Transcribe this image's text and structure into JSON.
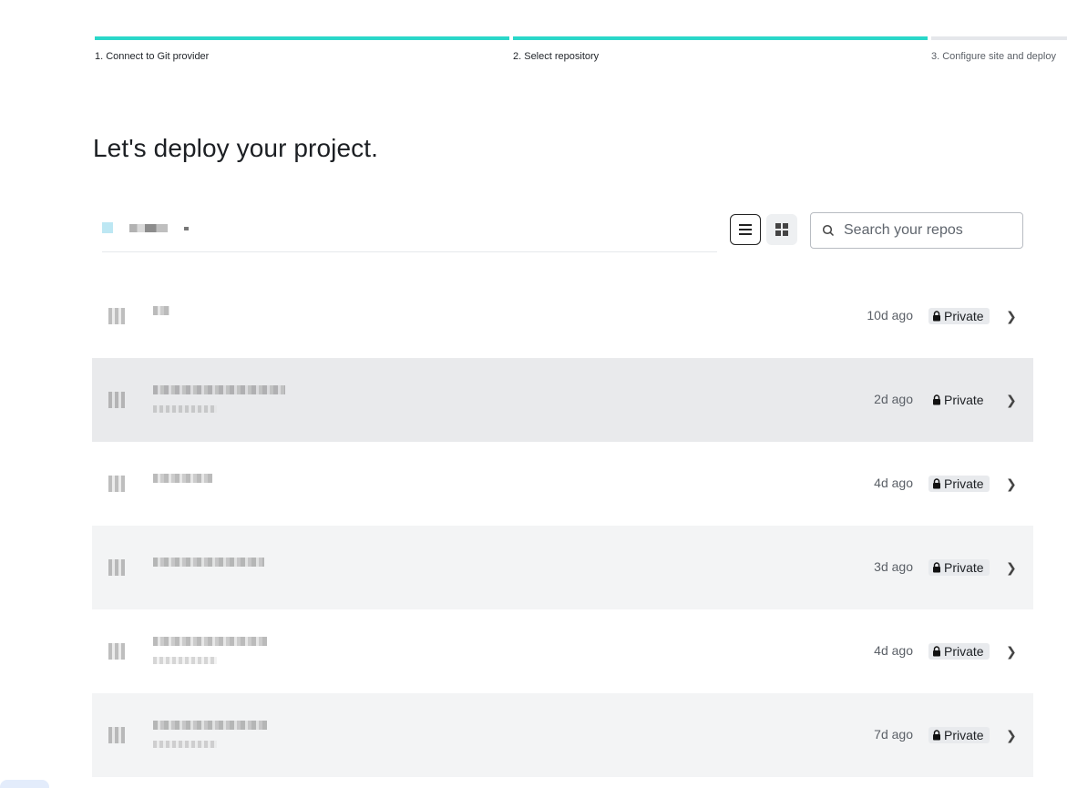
{
  "stepper": {
    "steps": [
      {
        "label": "1. Connect to Git provider",
        "state": "done"
      },
      {
        "label": "2. Select repository",
        "state": "done"
      },
      {
        "label": "3. Configure site and deploy",
        "state": "pending"
      }
    ],
    "accent_color": "#2ad7c9"
  },
  "page": {
    "title": "Let's deploy your project."
  },
  "toolbar": {
    "view_list_icon": "list-icon",
    "view_grid_icon": "grid-icon",
    "search_placeholder": "Search your repos",
    "search_icon": "search-icon"
  },
  "repos": [
    {
      "updated": "10d ago",
      "visibility": "Private",
      "icon": "lock-icon"
    },
    {
      "updated": "2d ago",
      "visibility": "Private",
      "icon": "lock-icon"
    },
    {
      "updated": "4d ago",
      "visibility": "Private",
      "icon": "lock-icon"
    },
    {
      "updated": "3d ago",
      "visibility": "Private",
      "icon": "lock-icon"
    },
    {
      "updated": "4d ago",
      "visibility": "Private",
      "icon": "lock-icon"
    },
    {
      "updated": "7d ago",
      "visibility": "Private",
      "icon": "lock-icon"
    }
  ]
}
